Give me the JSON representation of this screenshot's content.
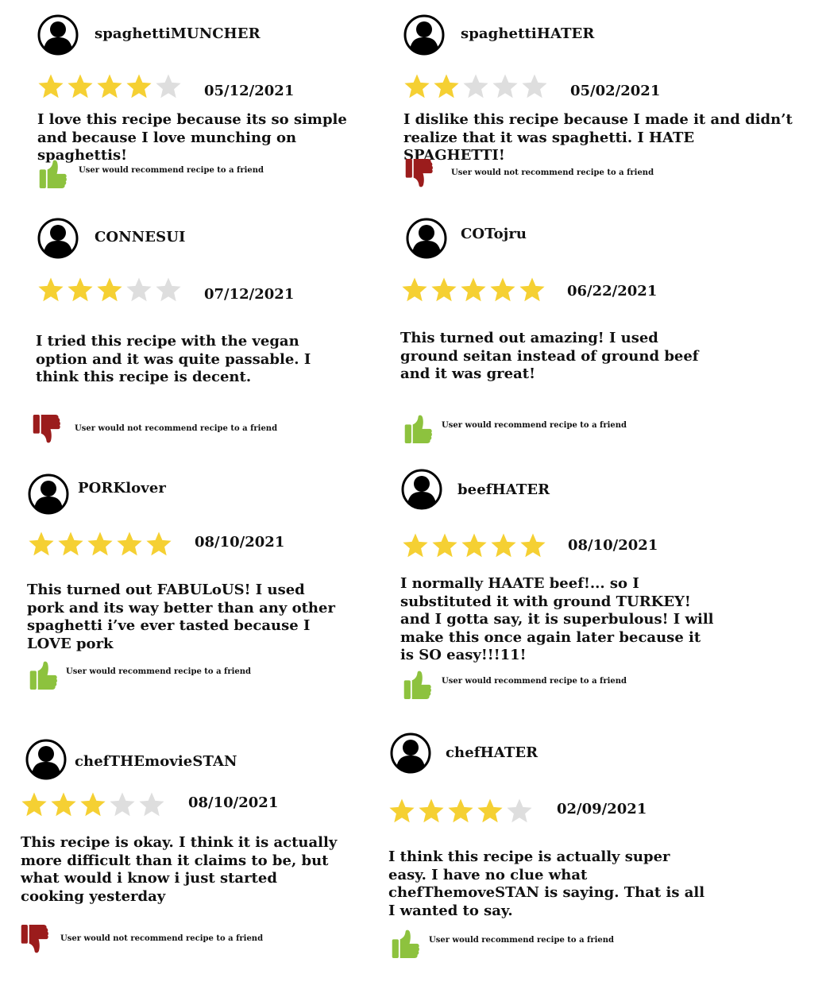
{
  "colors": {
    "star_filled": "#F5D033",
    "star_empty": "#DEDEDE",
    "thumb_up": "#8DC23E",
    "thumb_down": "#9B1C1C",
    "avatar": "#000000"
  },
  "reviews": [
    {
      "username": "spaghettiMUNCHER",
      "rating": 4,
      "date": "05/12/2021",
      "text": "I love this recipe because its so simple and because I love munching on spaghettis!",
      "recommend": true,
      "recommend_text": "User would recommend recipe to a friend",
      "avatar_icon": "user-avatar-icon",
      "thumb_icon": "thumbs-up-icon"
    },
    {
      "username": "spaghettiHATER",
      "rating": 2,
      "date": "05/02/2021",
      "text": "I dislike this recipe because I made it and didn’t realize that it was spaghetti. I HATE SPAGHETTI!",
      "recommend": false,
      "recommend_text": "User would not recommend recipe to a friend",
      "avatar_icon": "user-avatar-icon",
      "thumb_icon": "thumbs-down-icon"
    },
    {
      "username": "CONNESUI",
      "rating": 3,
      "date": "07/12/2021",
      "text": "I tried this recipe with the vegan option and it was quite passable. I think this recipe is decent.",
      "recommend": false,
      "recommend_text": "User would not recommend recipe to a friend",
      "avatar_icon": "user-avatar-icon",
      "thumb_icon": "thumbs-down-icon"
    },
    {
      "username": "COTojru",
      "rating": 5,
      "date": "06/22/2021",
      "text": "This turned out amazing! I used ground seitan instead of ground beef and it was great!",
      "recommend": true,
      "recommend_text": "User would recommend recipe to a friend",
      "avatar_icon": "user-avatar-icon",
      "thumb_icon": "thumbs-up-icon"
    },
    {
      "username": "PORKlover",
      "rating": 5,
      "date": "08/10/2021",
      "text": "This turned out FABULoUS! I used pork and its way better than any other spaghetti i’ve ever tasted because I LOVE pork",
      "recommend": true,
      "recommend_text": "User would recommend recipe to a friend",
      "avatar_icon": "user-avatar-icon",
      "thumb_icon": "thumbs-up-icon"
    },
    {
      "username": "beefHATER",
      "rating": 5,
      "date": "08/10/2021",
      "text": "I normally HAATE beef!... so I substituted it with ground TURKEY! and I gotta say, it is superbulous! I will make this once again later because it is SO easy!!!11!",
      "recommend": true,
      "recommend_text": "User would recommend recipe to a friend",
      "avatar_icon": "user-avatar-icon",
      "thumb_icon": "thumbs-up-icon"
    },
    {
      "username": "chefTHEmovieSTAN",
      "rating": 3,
      "date": "08/10/2021",
      "text": "This recipe is okay. I think it is actually more difficult than it claims to be, but what would i know i just started cooking yesterday",
      "recommend": false,
      "recommend_text": "User would not recommend recipe to a friend",
      "avatar_icon": "user-avatar-icon",
      "thumb_icon": "thumbs-down-icon"
    },
    {
      "username": "chefHATER",
      "rating": 4,
      "date": "02/09/2021",
      "text": "I think this recipe is actually super easy. I have no clue what chefThemoveSTAN is saying. That is all I wanted to say.",
      "recommend": true,
      "recommend_text": "User would recommend recipe to a friend",
      "avatar_icon": "user-avatar-icon",
      "thumb_icon": "thumbs-up-icon"
    }
  ]
}
